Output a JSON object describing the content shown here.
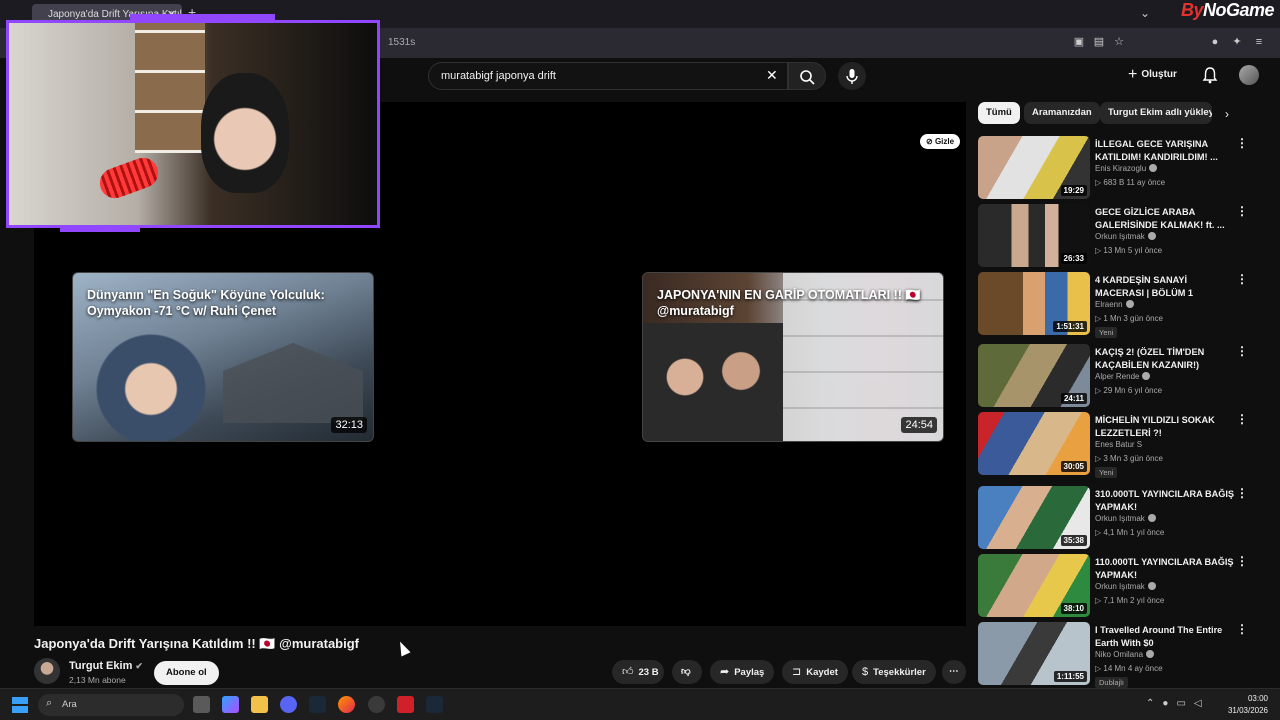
{
  "browser": {
    "tab_title": "Japonya'da Drift Yarışına Katıldı",
    "url_fragment": "1531s",
    "brand_prefix": "By",
    "brand_suffix": "NoGame"
  },
  "header": {
    "search_query": "muratabigf japonya drift",
    "create_label": "Oluştur"
  },
  "player": {
    "hide_label": "Gizle",
    "endcards": [
      {
        "title": "Dünyanın \"En Soğuk\" Köyüne Yolculuk: Oymyakon -71 °C w/ Ruhi Çenet",
        "duration": "32:13"
      },
      {
        "title": "JAPONYA'NIN EN GARİP OTOMATLARI !! 🇯🇵 @muratabigf",
        "duration": "24:54"
      }
    ]
  },
  "video": {
    "title": "Japonya'da Drift Yarışına Katıldım !! 🇯🇵 @muratabigf",
    "channel": "Turgut Ekim",
    "subscribers": "2,13 Mn abone",
    "subscribe_label": "Abone ol",
    "likes": "23 B",
    "share_label": "Paylaş",
    "save_label": "Kaydet",
    "thanks_label": "Teşekkürler"
  },
  "sidebar": {
    "chips": [
      "Tümü",
      "Aramanızdan",
      "Turgut Ekim adlı yükleyici"
    ],
    "items": [
      {
        "title": "İLLEGAL GECE YARIŞINA KATILDIM! KANDIRILDIM! ...",
        "channel": "Enis Kirazoglu",
        "meta": "▷ 683 B   11 ay önce",
        "duration": "19:29",
        "badge": ""
      },
      {
        "title": "GECE GİZLİCE ARABA GALERİSİNDE KALMAK! ft. ...",
        "channel": "Orkun Işıtmak",
        "meta": "▷ 13 Mn   5 yıl önce",
        "duration": "26:33",
        "badge": ""
      },
      {
        "title": "4 KARDEŞİN SANAYİ MACERASI | BÖLÜM 1",
        "channel": "Elraenn",
        "meta": "▷ 1 Mn   3 gün önce",
        "duration": "1:51:31",
        "badge": "Yeni"
      },
      {
        "title": "KAÇIŞ 2! (ÖZEL TİM'DEN KAÇABİLEN KAZANIR!)",
        "channel": "Alper Rende",
        "meta": "▷ 29 Mn   6 yıl önce",
        "duration": "24:11",
        "badge": ""
      },
      {
        "title": "MİCHELİN YILDIZLI SOKAK LEZZETLERİ ?!",
        "channel": "Enes Batur S",
        "meta": "▷ 3 Mn   3 gün önce",
        "duration": "30:05",
        "badge": "Yeni"
      },
      {
        "title": "310.000TL YAYINCILARA BAĞIŞ YAPMAK!",
        "channel": "Orkun Işıtmak",
        "meta": "▷ 4,1 Mn   1 yıl önce",
        "duration": "35:38",
        "badge": ""
      },
      {
        "title": "110.000TL YAYINCILARA BAĞIŞ YAPMAK!",
        "channel": "Orkun Işıtmak",
        "meta": "▷ 7,1 Mn   2 yıl önce",
        "duration": "38:10",
        "badge": ""
      },
      {
        "title": "I Travelled Around The Entire Earth With $0",
        "channel": "Niko Omilana",
        "meta": "▷ 14 Mn   4 ay önce",
        "duration": "1:11:55",
        "badge": "Dublajlı"
      }
    ]
  },
  "taskbar": {
    "search_placeholder": "Ara",
    "time": "03:00",
    "date": "31/03/2026"
  },
  "colors": {
    "accent_purple": "#9146ff",
    "background": "#0f0f0f",
    "chip_bg": "#272727"
  }
}
